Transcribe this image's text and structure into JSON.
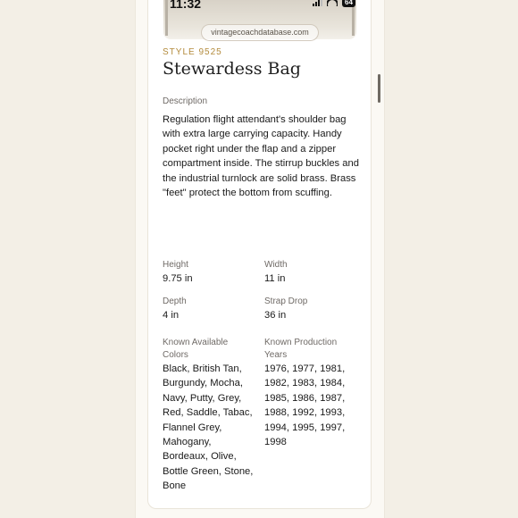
{
  "status_bar": {
    "time": "11:32",
    "battery": "64"
  },
  "browser": {
    "url": "vintagecoachdatabase.com"
  },
  "product": {
    "style": "STYLE 9525",
    "name": "Stewardess Bag",
    "description_label": "Description",
    "description": "Regulation flight attendant's shoulder bag with extra large carrying capacity. Handy pocket right under the flap and a zipper compartment inside. The stirrup buckles and the industrial turnlock are solid brass. Brass \"feet\" protect the bottom from scuffing."
  },
  "specs": {
    "height": {
      "label": "Height",
      "value": "9.75 in"
    },
    "width": {
      "label": "Width",
      "value": "11 in"
    },
    "depth": {
      "label": "Depth",
      "value": "4 in"
    },
    "strap_drop": {
      "label": "Strap Drop",
      "value": "36 in"
    },
    "colors": {
      "label": "Known Available Colors",
      "value": "Black, British Tan, Burgundy, Mocha, Navy, Putty, Grey, Red, Saddle, Tabac, Flannel Grey, Mahogany, Bordeaux, Olive, Bottle Green, Stone, Bone"
    },
    "years": {
      "label": "Known Production Years",
      "value": "1976, 1977, 1981, 1982, 1983, 1984, 1985, 1986, 1987, 1988, 1992, 1993, 1994, 1995, 1997, 1998"
    }
  },
  "colors": {
    "accent": "#b38b3c",
    "background": "#f3efe6",
    "text": "#1a1a1a"
  }
}
